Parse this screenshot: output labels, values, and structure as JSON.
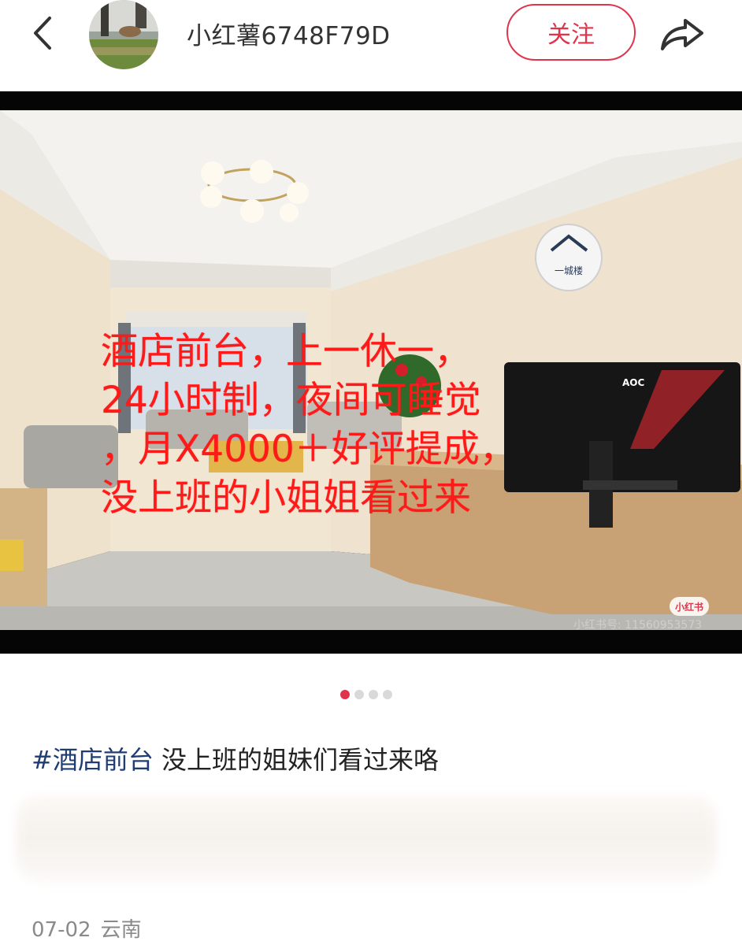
{
  "header": {
    "back_icon": "chevron-left-icon",
    "username": "小红薯6748F79D",
    "follow_label": "关注",
    "share_icon": "share-arrow-icon"
  },
  "media": {
    "overlay_lines": [
      "酒店前台，上一休一，",
      "24小时制，夜间可睡觉",
      "，月X4000＋好评提成，",
      "没上班的小姐姐看过来"
    ],
    "wall_logo_text": "一城楼",
    "monitor_brand": "AOC",
    "watermark_badge": "小红书",
    "watermark_id": "小红书号: 11560953573",
    "overlay_color": "#ff1a1a"
  },
  "pagination": {
    "total": 4,
    "active_index": 0,
    "active_color": "#e0344d"
  },
  "caption": {
    "hashtag": "#酒店前台",
    "text": "没上班的姐妹们看过来咯"
  },
  "meta": {
    "date": "07-02",
    "location": "云南"
  },
  "colors": {
    "brand": "#e0344d",
    "hashtag": "#1f3c73"
  }
}
